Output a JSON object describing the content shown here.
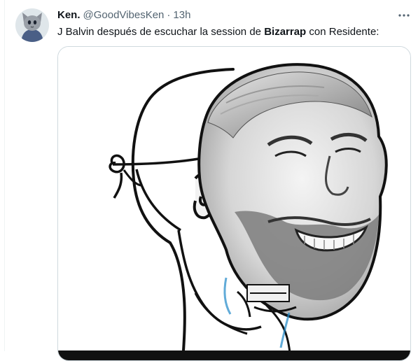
{
  "tweet": {
    "author_name": "Ken.",
    "author_handle": "@GoodVibesKen",
    "separator": "·",
    "timestamp": "13h",
    "text_before": "J Balvin después de escuchar la session de ",
    "text_bold": "Bizarrap",
    "text_after": " con Residente:",
    "more_icon": "more-horizontal-icon",
    "avatar_icon": "cat-avatar-icon"
  },
  "colors": {
    "text_primary": "#0f1419",
    "text_secondary": "#536471",
    "border": "#cfd9de"
  }
}
